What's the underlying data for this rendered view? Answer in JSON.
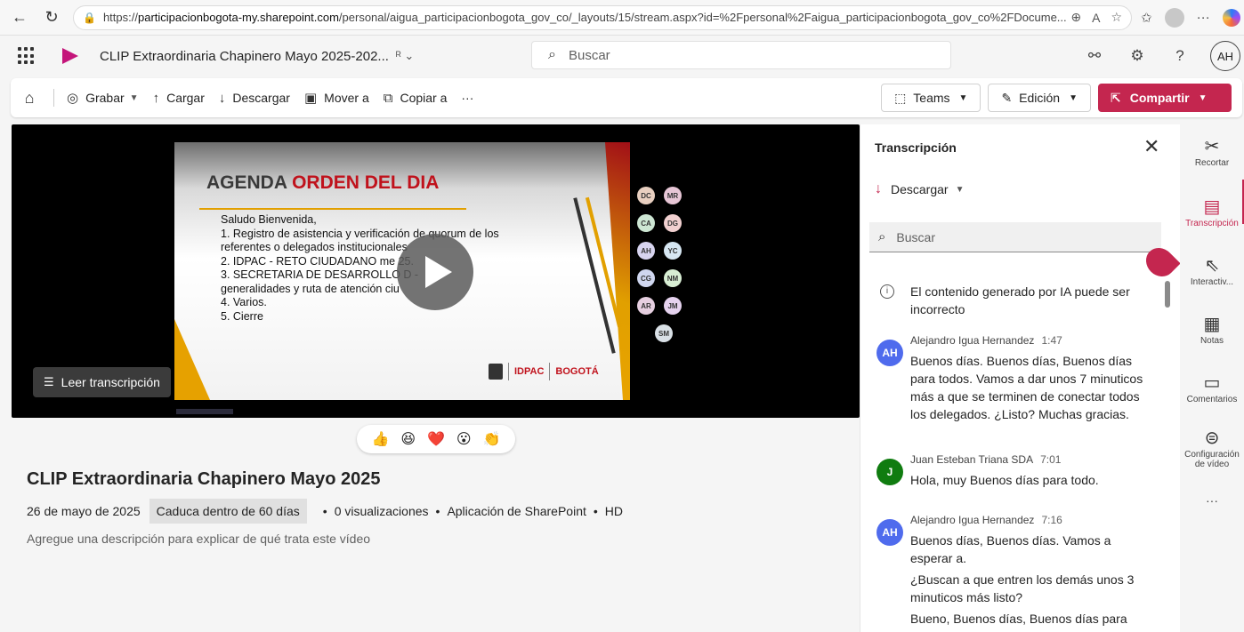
{
  "browser": {
    "url_prefix": "https://",
    "url_domain": "participacionbogota-my.sharepoint.com",
    "url_path": "/personal/aigua_participacionbogota_gov_co/_layouts/15/stream.aspx?id=%2Fpersonal%2Faigua_participacionbogota_gov_co%2FDocume..."
  },
  "header": {
    "doc_title": "CLIP Extraordinaria Chapinero Mayo 2025-202...",
    "search_placeholder": "Buscar",
    "avatar_initials": "AH"
  },
  "commands": {
    "record": "Grabar",
    "upload": "Cargar",
    "download": "Descargar",
    "move": "Mover a",
    "copy": "Copiar a",
    "more": "···",
    "teams": "Teams",
    "edit": "Edición",
    "share": "Compartir"
  },
  "slide": {
    "title_dark": "AGENDA ",
    "title_red": "ORDEN DEL DIA",
    "body": "Saludo Bienvenida,\n1. Registro de asistencia y verificación de quorum de los\nreferentes o delegados institucionales\n2. IDPAC - RETO CIUDADANO me          25.\n3. SECRETARIA DE DESARROLLO          D -\ngeneralidades y ruta de atención ciu\n4. Varios.\n5. Cierre",
    "logo_idpac": "IDPAC",
    "logo_bogota": "BOGOTÁ"
  },
  "participants": [
    {
      "initials": "DC",
      "color": "#e8cfc0"
    },
    {
      "initials": "MR",
      "color": "#e7c6d6"
    },
    {
      "initials": "CA",
      "color": "#cde6d3"
    },
    {
      "initials": "DG",
      "color": "#f1d0d0"
    },
    {
      "initials": "AH",
      "color": "#d7d4ef"
    },
    {
      "initials": "YC",
      "color": "#d6e6f2"
    },
    {
      "initials": "CG",
      "color": "#cfd6ef"
    },
    {
      "initials": "NM",
      "color": "#d8eed4"
    },
    {
      "initials": "AR",
      "color": "#e6cfe0"
    },
    {
      "initials": "JM",
      "color": "#e5d2ee"
    },
    {
      "initials": "SM",
      "color": "#d9e0e6"
    }
  ],
  "video": {
    "read_transcript": "Leer transcripción"
  },
  "reactions": [
    "👍",
    "😆",
    "❤️",
    "😮",
    "👏"
  ],
  "details": {
    "title": "CLIP Extraordinaria Chapinero Mayo 2025",
    "date": "26 de mayo de 2025",
    "expires": "Caduca dentro de 60 días",
    "views": "0 visualizaciones",
    "app": "Aplicación de SharePoint",
    "quality": "HD",
    "description": "Agregue una descripción para explicar de qué trata este vídeo"
  },
  "transcript": {
    "title": "Transcripción",
    "download": "Descargar",
    "search_placeholder": "Buscar",
    "ai_note": "El contenido generado por IA puede ser incorrecto",
    "entries": [
      {
        "initials": "AH",
        "color": "#4f6bed",
        "name": "Alejandro Igua Hernandez",
        "time": "1:47",
        "text": "Buenos días. Buenos días, Buenos días para todos. Vamos a dar unos 7 minuticos más a que se terminen de conectar todos los delegados. ¿Listo? Muchas gracias."
      },
      {
        "initials": "J",
        "color": "#107c10",
        "name": "Juan Esteban Triana SDA",
        "time": "7:01",
        "text": "Hola, muy Buenos días para todo."
      },
      {
        "initials": "AH",
        "color": "#4f6bed",
        "name": "Alejandro Igua Hernandez",
        "time": "7:16",
        "text": "Buenos días, Buenos días. Vamos a esperar a.",
        "text2": "¿Buscan a que entren los demás unos 3 minuticos más listo?",
        "text3": "Bueno, Buenos días, Buenos días para"
      }
    ]
  },
  "rail": {
    "trim": "Recortar",
    "transcript": "Transcripción",
    "interactive": "Interactiv...",
    "notes": "Notas",
    "comments": "Comentarios",
    "video_settings": "Configuración de vídeo",
    "more": "···"
  }
}
